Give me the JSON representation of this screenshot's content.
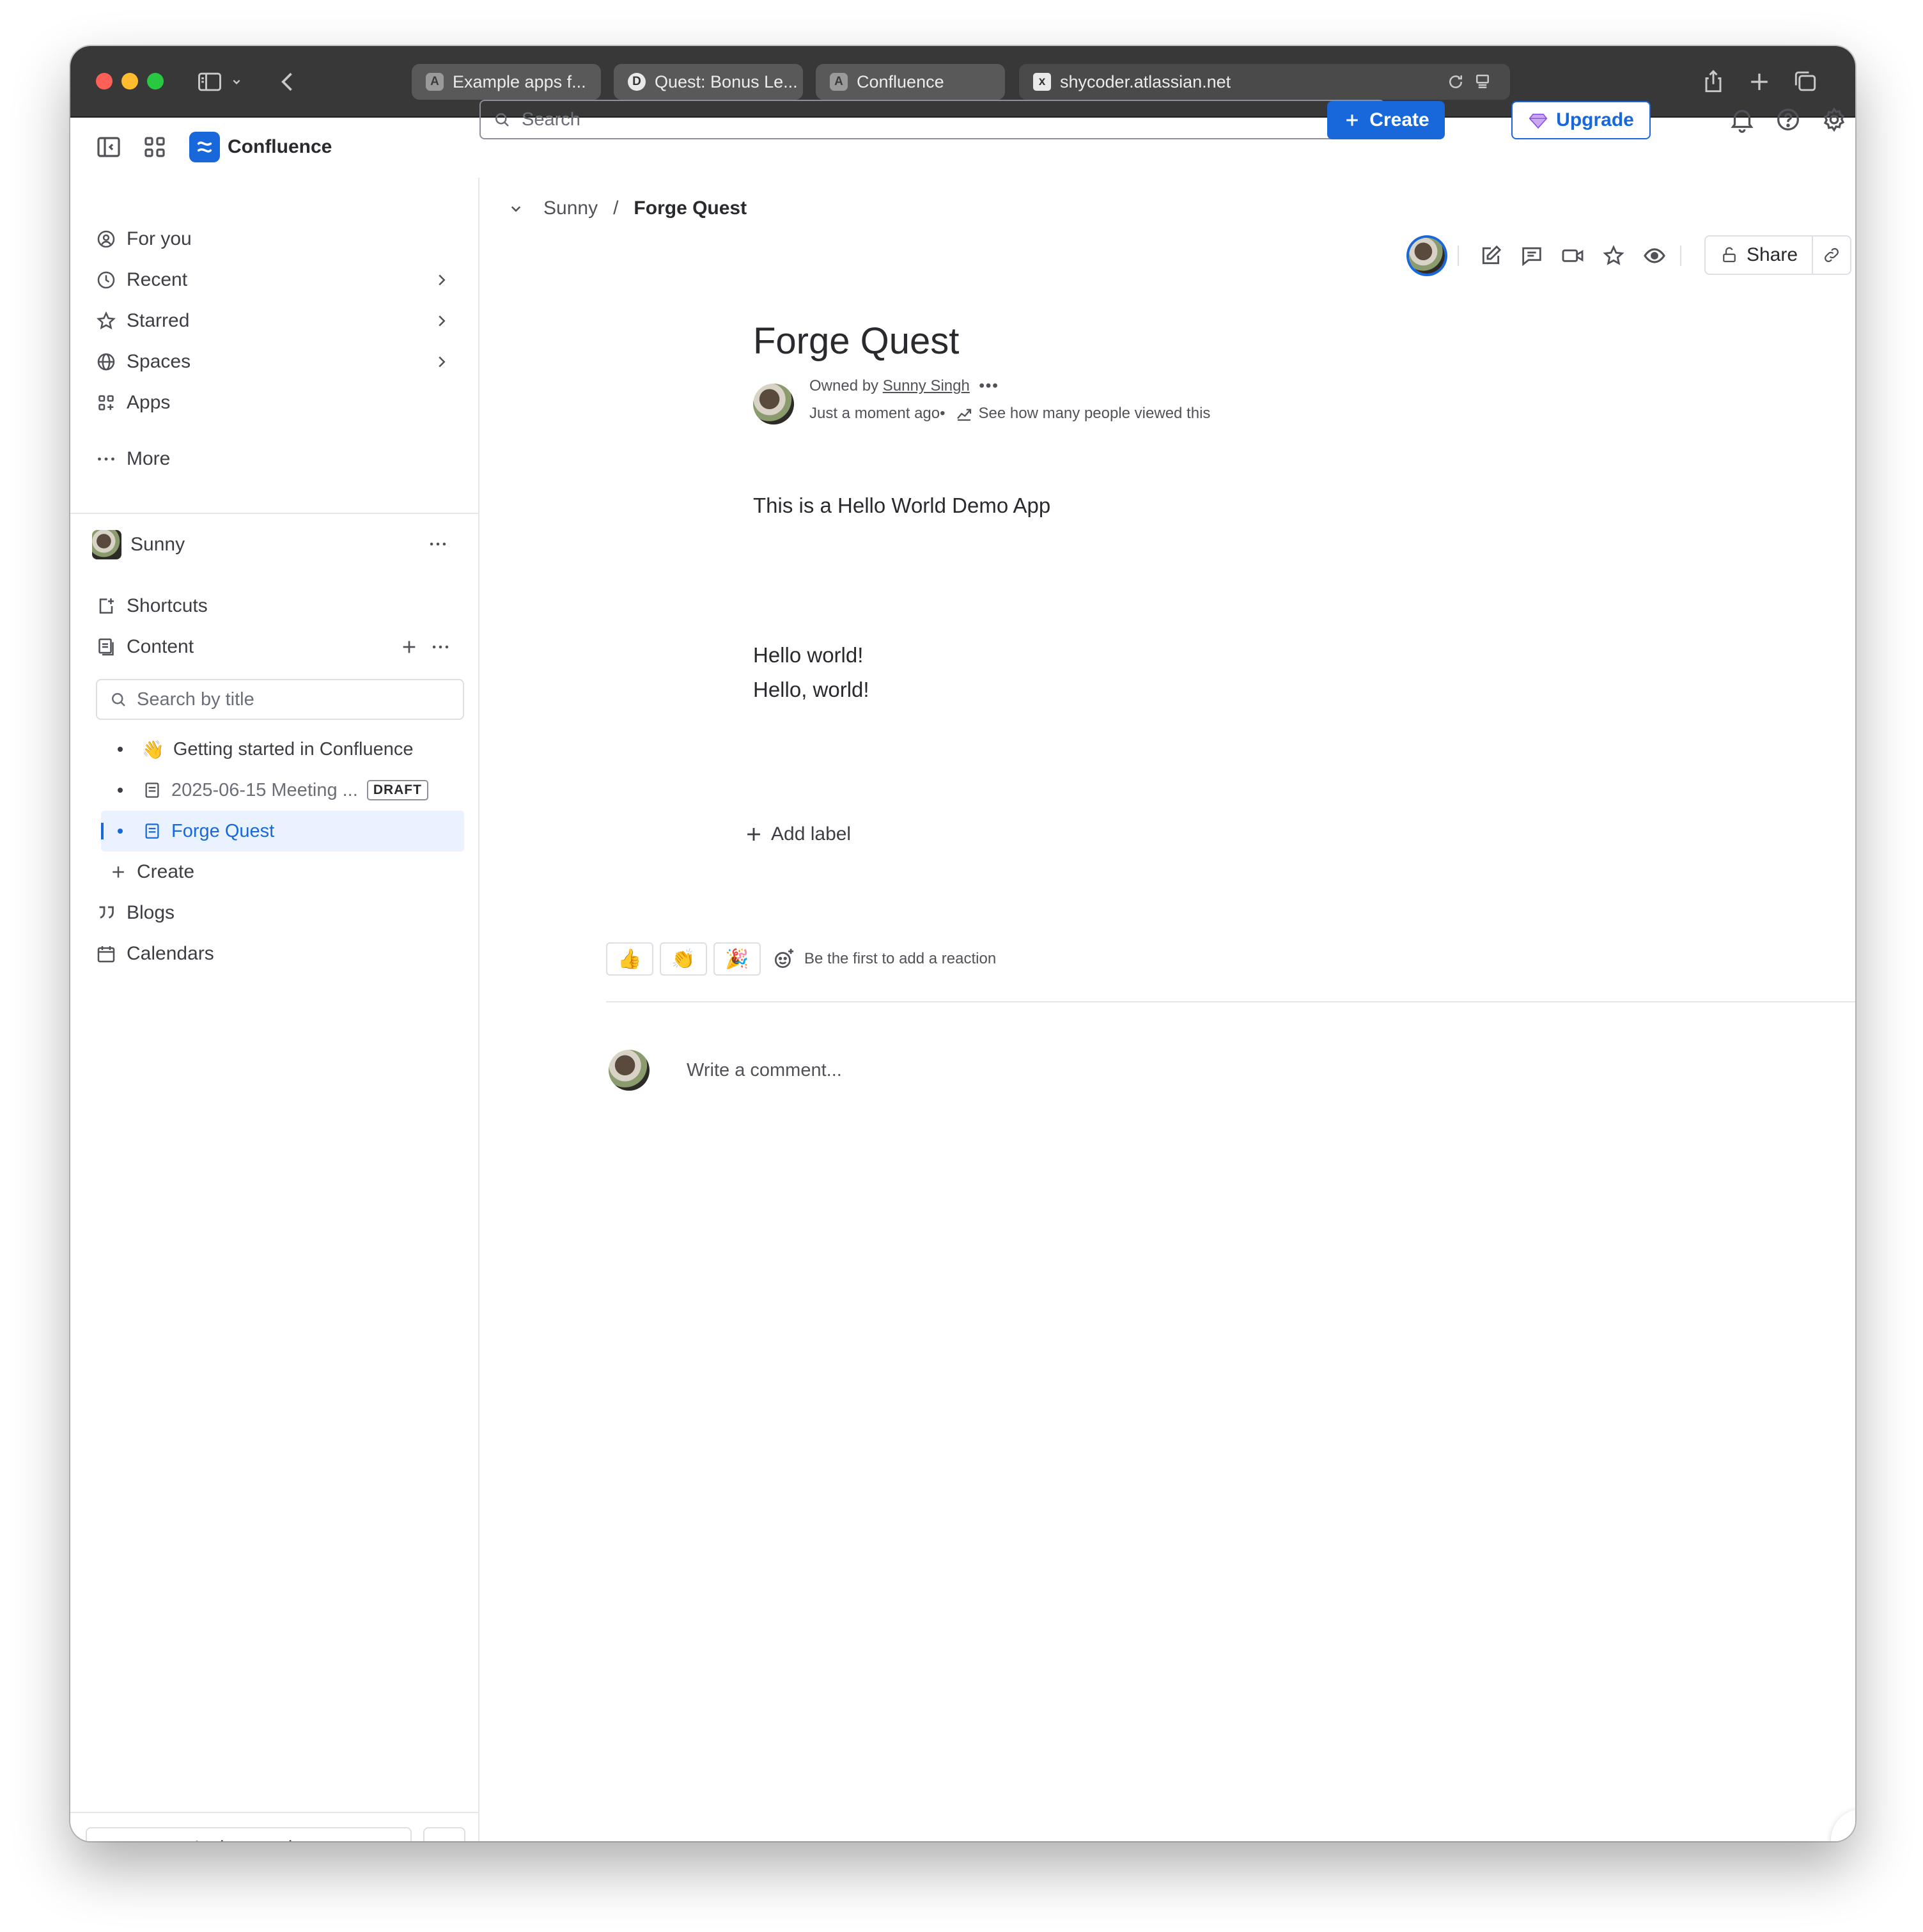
{
  "browser": {
    "tabs": [
      {
        "favicon": "A",
        "label": "Example apps f..."
      },
      {
        "favicon": "D",
        "label": "Quest: Bonus Le..."
      },
      {
        "favicon": "A",
        "label": "Confluence"
      },
      {
        "favicon": "x",
        "label": "shycoder.atlassian.net"
      }
    ]
  },
  "header": {
    "brand": "Confluence",
    "search_placeholder": "Search",
    "create_label": "Create",
    "upgrade_label": "Upgrade"
  },
  "sidebar": {
    "nav": [
      {
        "label": "For you",
        "icon": "user-circle-icon"
      },
      {
        "label": "Recent",
        "icon": "clock-icon"
      },
      {
        "label": "Starred",
        "icon": "star-icon"
      },
      {
        "label": "Spaces",
        "icon": "globe-icon"
      },
      {
        "label": "Apps",
        "icon": "apps-icon"
      },
      {
        "label": "More",
        "icon": "more-icon"
      }
    ],
    "space_name": "Sunny",
    "shortcuts_label": "Shortcuts",
    "content_label": "Content",
    "search_placeholder": "Search by title",
    "tree": [
      {
        "label": "Getting started in Confluence",
        "icon": "👋"
      },
      {
        "label": "2025-06-15 Meeting ...",
        "badge": "DRAFT"
      },
      {
        "label": "Forge Quest"
      }
    ],
    "create_label": "Create",
    "blogs_label": "Blogs",
    "calendars_label": "Calendars",
    "invite_label": "Invite people"
  },
  "page": {
    "breadcrumb_space": "Sunny",
    "breadcrumb_sep": "/",
    "breadcrumb_current": "Forge Quest",
    "share_label": "Share",
    "title": "Forge Quest",
    "owned_prefix": "Owned by",
    "owner": "Sunny Singh",
    "owner_more": "•••",
    "updated": "Just a moment ago•",
    "views_link": "See how many people viewed this",
    "body": [
      "This is a Hello World Demo App",
      "Hello world!",
      "Hello, world!"
    ],
    "add_label": "Add label",
    "reactions": [
      "👍",
      "👏",
      "🎉"
    ],
    "reaction_prompt": "Be the first to add a reaction",
    "comment_placeholder": "Write a comment..."
  },
  "colors": {
    "accent": "#1868db",
    "selected_bg": "#e9f2fe",
    "chrome": "#383838"
  }
}
